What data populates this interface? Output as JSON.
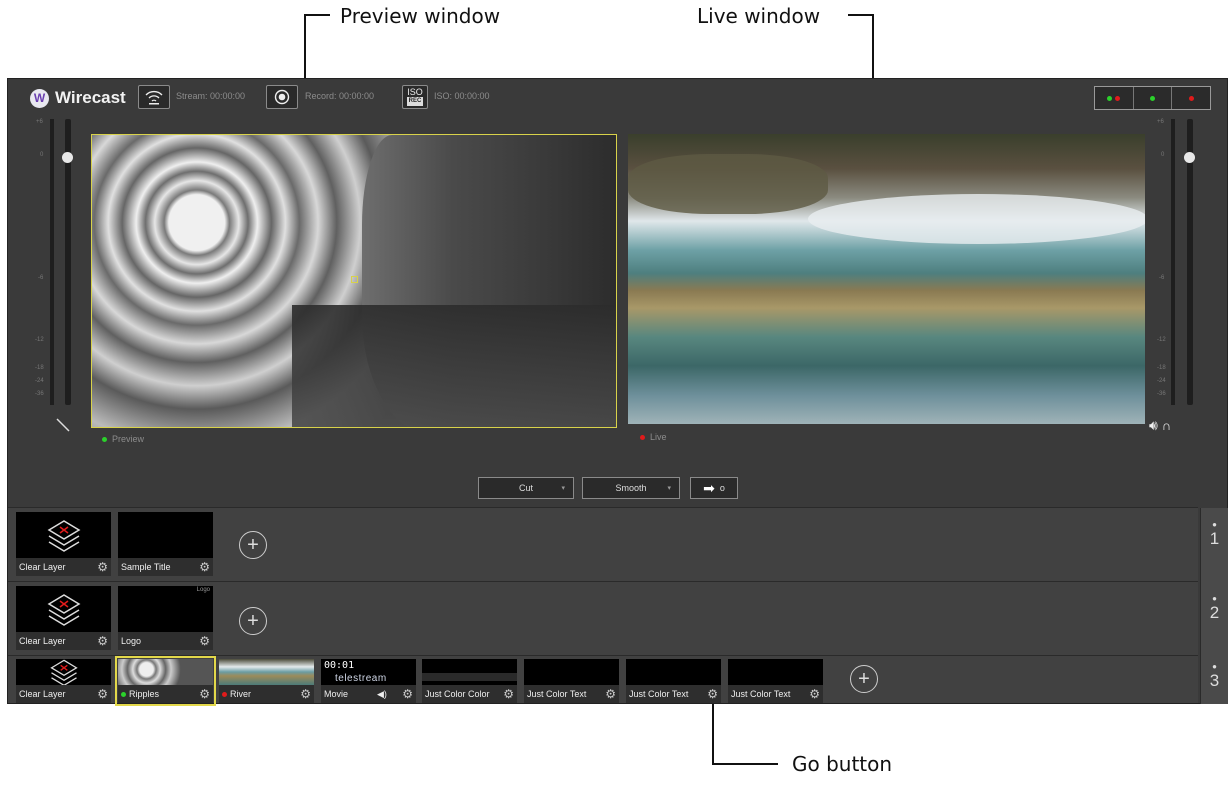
{
  "annotations": {
    "preview_window": "Preview window",
    "live_window": "Live window",
    "go_button": "Go button"
  },
  "toolbar": {
    "app_name": "Wirecast",
    "stream_label": "Stream: 00:00:00",
    "record_label": "Record: 00:00:00",
    "iso_label": "ISO: 00:00:00",
    "iso_button_top": "ISO",
    "iso_button_bottom": "REC"
  },
  "status_indicators": [
    {
      "dots": [
        "#2bd12b",
        "#e01b1b"
      ]
    },
    {
      "dots": [
        "#2bd12b"
      ]
    },
    {
      "dots": [
        "#e01b1b"
      ]
    }
  ],
  "meters": {
    "left_ticks": [
      "+6",
      "0",
      "-6",
      "-12",
      "-18",
      "-24",
      "-36"
    ],
    "right_ticks": [
      "+6",
      "0",
      "-6",
      "-12",
      "-18",
      "-24",
      "-36"
    ]
  },
  "preview": {
    "label": "Preview",
    "indicator_color": "#2bd12b"
  },
  "live": {
    "label": "Live",
    "indicator_color": "#e01b1b"
  },
  "transitions": {
    "first": "Cut",
    "second": "Smooth",
    "go_icon": "➡"
  },
  "layers": [
    {
      "number": "1",
      "shots": [
        {
          "name": "Clear Layer",
          "type": "clear"
        },
        {
          "name": "Sample Title",
          "type": "black"
        }
      ]
    },
    {
      "number": "2",
      "shots": [
        {
          "name": "Clear Layer",
          "type": "clear"
        },
        {
          "name": "Logo",
          "type": "logo",
          "thumb_text": "Logo"
        }
      ]
    },
    {
      "number": "3",
      "shots": [
        {
          "name": "Clear Layer",
          "type": "clear"
        },
        {
          "name": "Ripples",
          "type": "ripples",
          "status": "#2bd12b"
        },
        {
          "name": "River",
          "type": "river",
          "status": "#e01b1b"
        },
        {
          "name": "Movie",
          "type": "movie",
          "time": "00:01",
          "brand": "telestream"
        },
        {
          "name": "Just Color Color",
          "type": "bar"
        },
        {
          "name": "Just Color Text",
          "type": "black"
        },
        {
          "name": "Just Color Text",
          "type": "black"
        },
        {
          "name": "Just Color Text",
          "type": "black"
        }
      ]
    }
  ]
}
